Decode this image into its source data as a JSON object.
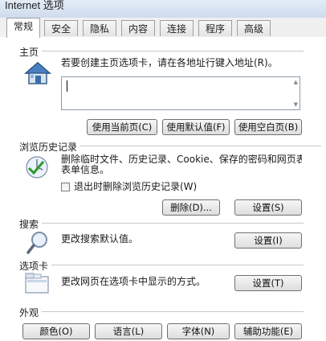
{
  "window": {
    "title": "Internet 选项"
  },
  "tabs": [
    {
      "label": "常规",
      "active": true
    },
    {
      "label": "安全"
    },
    {
      "label": "隐私"
    },
    {
      "label": "内容"
    },
    {
      "label": "连接"
    },
    {
      "label": "程序"
    },
    {
      "label": "高级"
    }
  ],
  "home": {
    "title": "主页",
    "description": "若要创建主页选项卡，请在各地址行键入地址(R)。",
    "value": "",
    "buttons": {
      "use_current": "使用当前页(C)",
      "use_default": "使用默认值(F)",
      "use_blank": "使用空白页(B)"
    }
  },
  "history": {
    "title": "浏览历史记录",
    "description_line1": "删除临时文件、历史记录、Cookie、保存的密码和网页表单信息。",
    "description_line2": "表单信息。",
    "checkbox_label": "退出时删除浏览历史记录(W)",
    "checkbox_checked": false,
    "buttons": {
      "delete": "删除(D)...",
      "settings": "设置(S)"
    }
  },
  "search": {
    "title": "搜索",
    "description": "更改搜索默认值。",
    "buttons": {
      "settings": "设置(I)"
    }
  },
  "tabs_section": {
    "title": "选项卡",
    "description": "更改网页在选项卡中显示的方式。",
    "buttons": {
      "settings": "设置(T)"
    }
  },
  "appearance": {
    "title": "外观",
    "buttons": {
      "colors": "颜色(O)",
      "languages": "语言(L)",
      "fonts": "字体(N)",
      "accessibility": "辅助功能(E)"
    }
  },
  "icons": {
    "home": "house-icon",
    "history": "history-check-icon",
    "search": "magnifier-icon",
    "tabs": "tabs-window-icon"
  },
  "colors": {
    "accent": "#2a6ebd",
    "border": "#707070"
  }
}
